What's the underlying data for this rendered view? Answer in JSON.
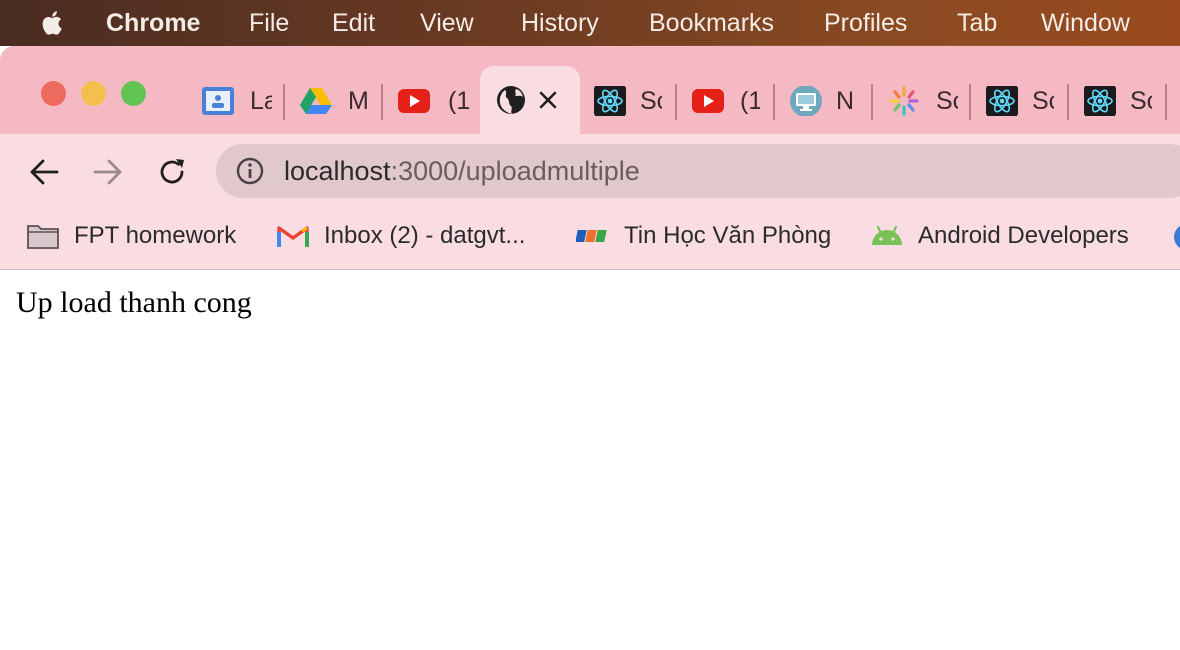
{
  "menubar": {
    "app_name": "Chrome",
    "items": [
      "File",
      "Edit",
      "View",
      "History",
      "Bookmarks",
      "Profiles",
      "Tab",
      "Window"
    ]
  },
  "tabs": [
    {
      "title": "La",
      "icon": "classroom-icon"
    },
    {
      "title": "M",
      "icon": "google-drive-icon"
    },
    {
      "title": "(1",
      "icon": "youtube-icon"
    },
    {
      "title": "",
      "icon": "globe-icon",
      "active": true
    },
    {
      "title": "Sc",
      "icon": "react-icon"
    },
    {
      "title": "(1",
      "icon": "youtube-icon"
    },
    {
      "title": "N",
      "icon": "monitor-icon"
    },
    {
      "title": "Sc",
      "icon": "pinwheel-icon"
    },
    {
      "title": "Sc",
      "icon": "react-icon"
    },
    {
      "title": "Sc",
      "icon": "react-icon"
    }
  ],
  "address_bar": {
    "host": "localhost",
    "path": ":3000/uploadmultiple"
  },
  "bookmarks": [
    {
      "label": "FPT homework",
      "icon": "folder-icon"
    },
    {
      "label": "Inbox (2) - datgvt...",
      "icon": "gmail-icon"
    },
    {
      "label": "Tin Học Văn Phòng",
      "icon": "fpt-icon"
    },
    {
      "label": "Android Developers",
      "icon": "android-icon"
    }
  ],
  "page": {
    "message": "Up load thanh cong"
  },
  "colors": {
    "tabstrip": "#f5b9c4",
    "toolbar": "#f9dde2",
    "omnibox": "#e0c8cd"
  }
}
